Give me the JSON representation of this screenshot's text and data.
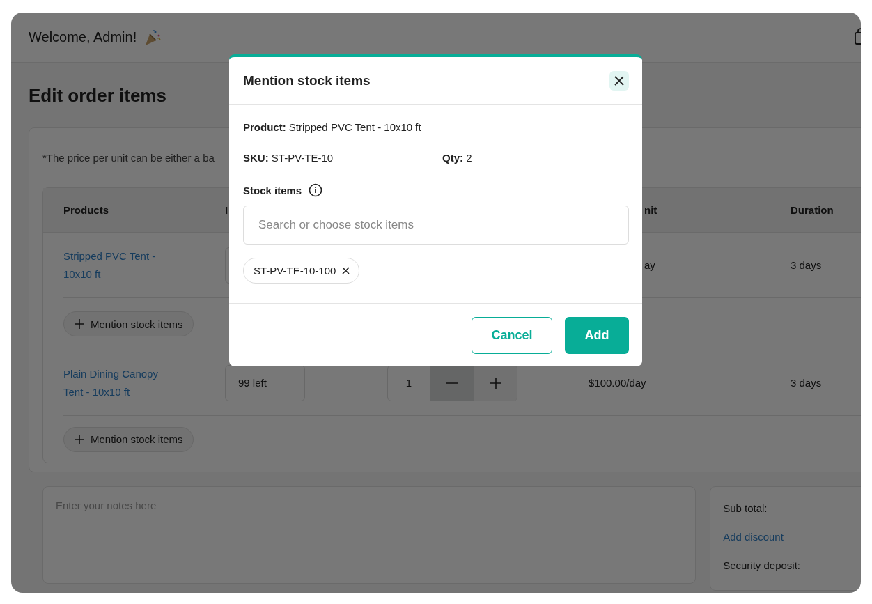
{
  "header": {
    "greeting": "Welcome, Admin!"
  },
  "page_title": "Edit order items",
  "price_note": "*The price per unit can be either a ba",
  "table": {
    "columns": {
      "products": "Products",
      "column_2": "I",
      "column_4": "nit",
      "duration": "Duration"
    },
    "rows": [
      {
        "product": "Stripped PVC Tent - 10x10 ft",
        "column_4": "ay",
        "duration": "3 days",
        "mention_button": "Mention stock items"
      },
      {
        "product": "Plain Dining Canopy Tent - 10x10 ft",
        "inventory": "99 left",
        "quantity": "1",
        "price": "$100.00/day",
        "duration": "3 days",
        "mention_button": "Mention stock items"
      }
    ]
  },
  "notes": {
    "placeholder": "Enter your notes here"
  },
  "summary": {
    "sub_total": "Sub total:",
    "add_discount": "Add discount",
    "security_deposit": "Security deposit:"
  },
  "modal": {
    "title": "Mention stock items",
    "product": "**Product:** Stripped PVC Tent - 10x10 ft",
    "sku": "**SKU:** ST-PV-TE-10",
    "qty": "**Qty:** 2",
    "stock_label": "Stock items",
    "search_placeholder": "Search or choose stock items",
    "chips": [
      "ST-PV-TE-10-100"
    ],
    "cancel": "Cancel",
    "add": "Add"
  }
}
